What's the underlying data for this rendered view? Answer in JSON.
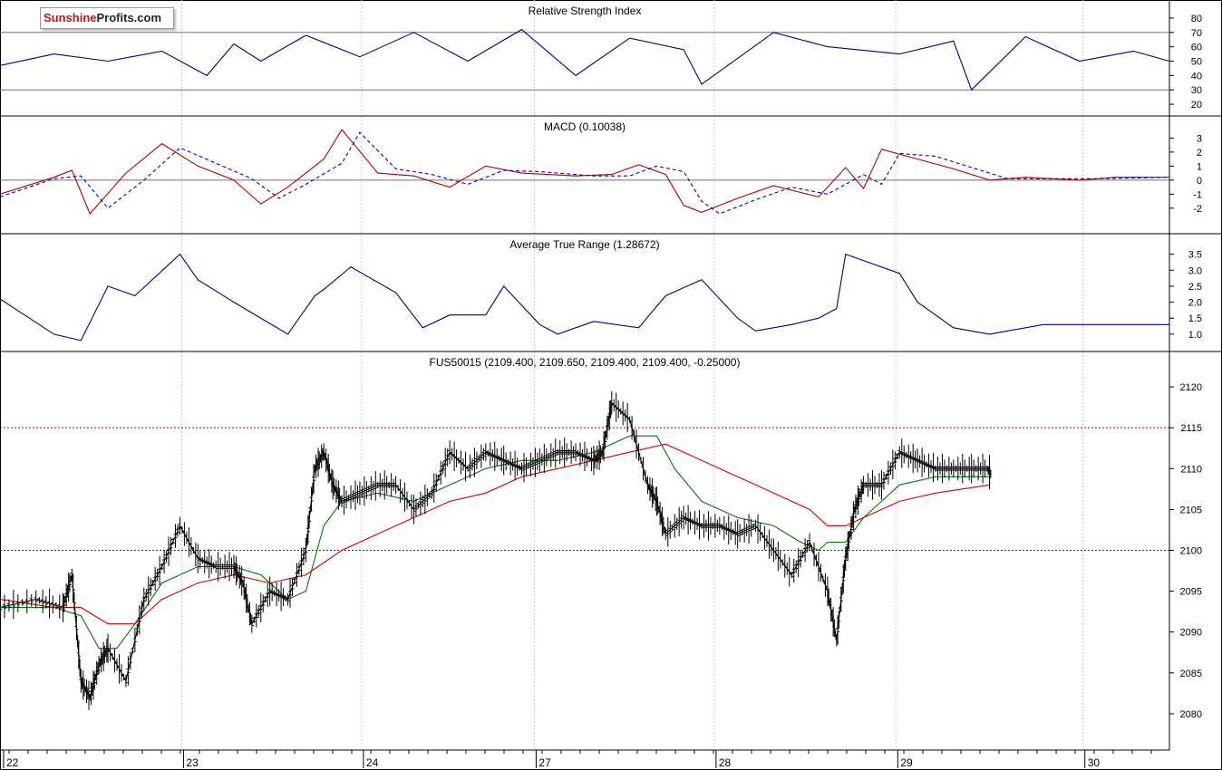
{
  "brand": {
    "part1": "Sunshine",
    "part2": "Profits.com"
  },
  "chart_data": [
    {
      "type": "line",
      "title": "Relative Strength Index",
      "ylim": [
        15,
        85
      ],
      "yticks": [
        20,
        30,
        40,
        50,
        60,
        70,
        80
      ],
      "hlines": [
        30,
        70
      ],
      "series": [
        {
          "color": "#000080",
          "x": [
            0,
            0.3,
            0.6,
            0.9,
            1.15,
            1.3,
            1.45,
            1.7,
            2.0,
            2.3,
            2.6,
            2.9,
            3.2,
            3.5,
            3.8,
            3.9,
            4.3,
            4.6,
            5.0,
            5.3,
            5.4,
            5.7,
            6.0,
            6.3,
            6.5
          ],
          "values": [
            47,
            55,
            50,
            57,
            40,
            62,
            50,
            68,
            53,
            70,
            50,
            72,
            40,
            66,
            58,
            34,
            70,
            60,
            55,
            64,
            30,
            67,
            50,
            57,
            50
          ]
        }
      ]
    },
    {
      "type": "line",
      "title": "MACD (0.10038)",
      "ylim": [
        -3.5,
        3.8
      ],
      "yticks": [
        -2,
        -1,
        0,
        1,
        2,
        3
      ],
      "hlines": [
        0
      ],
      "series": [
        {
          "color": "#b00000",
          "dash": false,
          "x": [
            0,
            0.3,
            0.4,
            0.5,
            0.7,
            0.9,
            1.1,
            1.3,
            1.45,
            1.6,
            1.8,
            1.9,
            2.1,
            2.3,
            2.5,
            2.7,
            2.9,
            3.2,
            3.4,
            3.55,
            3.7,
            3.8,
            3.9,
            4.1,
            4.3,
            4.55,
            4.7,
            4.8,
            4.9,
            5.1,
            5.3,
            5.5,
            5.7,
            6.0,
            6.2,
            6.5
          ],
          "values": [
            -1.0,
            0.2,
            0.7,
            -2.4,
            0.5,
            2.6,
            1.0,
            0.0,
            -1.7,
            -0.5,
            1.5,
            3.6,
            0.5,
            0.3,
            -0.5,
            1.0,
            0.5,
            0.3,
            0.4,
            1.1,
            0.4,
            -1.8,
            -2.3,
            -1.3,
            -0.4,
            -1.2,
            0.9,
            -0.6,
            2.2,
            1.5,
            0.8,
            0.0,
            0.2,
            0.0,
            0.2,
            0.2
          ]
        },
        {
          "color": "#0000cc",
          "dash": true,
          "x": [
            0,
            0.3,
            0.45,
            0.6,
            0.8,
            1.0,
            1.2,
            1.4,
            1.55,
            1.7,
            1.9,
            2.0,
            2.2,
            2.4,
            2.6,
            2.8,
            3.0,
            3.3,
            3.5,
            3.65,
            3.8,
            3.9,
            4.0,
            4.2,
            4.4,
            4.6,
            4.8,
            4.9,
            5.0,
            5.2,
            5.4,
            5.6,
            5.8,
            6.1,
            6.5
          ],
          "values": [
            -1.2,
            0.1,
            0.3,
            -2.0,
            0.0,
            2.3,
            1.2,
            0.1,
            -1.3,
            -0.3,
            1.2,
            3.4,
            0.8,
            0.4,
            -0.3,
            0.7,
            0.6,
            0.3,
            0.3,
            1.0,
            0.6,
            -1.5,
            -2.4,
            -1.4,
            -0.5,
            -1.0,
            0.4,
            -0.3,
            1.9,
            1.7,
            0.9,
            0.1,
            0.1,
            0.1,
            0.2
          ]
        }
      ]
    },
    {
      "type": "line",
      "title": "Average True Range (1.28672)",
      "ylim": [
        0.6,
        3.8
      ],
      "yticks": [
        1.0,
        1.5,
        2.0,
        2.5,
        3.0,
        3.5
      ],
      "series": [
        {
          "color": "#000080",
          "x": [
            0,
            0.3,
            0.45,
            0.6,
            0.75,
            1.0,
            1.1,
            1.3,
            1.6,
            1.75,
            1.8,
            1.95,
            2.2,
            2.35,
            2.5,
            2.7,
            2.8,
            3.0,
            3.1,
            3.3,
            3.55,
            3.7,
            3.9,
            4.1,
            4.2,
            4.4,
            4.55,
            4.65,
            4.7,
            5.0,
            5.1,
            5.3,
            5.5,
            5.6,
            5.8,
            6.0,
            6.5
          ],
          "values": [
            2.1,
            1.0,
            0.8,
            2.5,
            2.2,
            3.5,
            2.7,
            2.0,
            1.0,
            2.2,
            2.4,
            3.1,
            2.3,
            1.2,
            1.6,
            1.6,
            2.5,
            1.3,
            1.0,
            1.4,
            1.2,
            2.2,
            2.7,
            1.5,
            1.1,
            1.3,
            1.5,
            1.8,
            3.5,
            2.9,
            2.0,
            1.2,
            1.0,
            1.1,
            1.3,
            1.3,
            1.3
          ]
        }
      ]
    },
    {
      "type": "line",
      "title": "FUS50015 (2109.400, 2109.650, 2109.400, 2109.400, -0.25000)",
      "ylim": [
        2076,
        2123
      ],
      "yticks": [
        2080,
        2085,
        2090,
        2095,
        2100,
        2105,
        2110,
        2115,
        2120
      ],
      "hlines": [
        2100,
        2115
      ],
      "xlim": [
        0,
        6.5
      ],
      "xticks": [
        {
          "label": "22",
          "x": 0.02
        },
        {
          "label": "23",
          "x": 1.02
        },
        {
          "label": "24",
          "x": 2.02
        },
        {
          "label": "27",
          "x": 2.98
        },
        {
          "label": "28",
          "x": 3.98
        },
        {
          "label": "29",
          "x": 4.99
        },
        {
          "label": "30",
          "x": 6.03
        }
      ],
      "series": [
        {
          "name": "price",
          "color": "#000000",
          "x": [
            0,
            0.2,
            0.35,
            0.4,
            0.45,
            0.5,
            0.55,
            0.6,
            0.7,
            0.8,
            0.9,
            1.0,
            1.1,
            1.2,
            1.3,
            1.35,
            1.4,
            1.5,
            1.6,
            1.7,
            1.75,
            1.8,
            1.85,
            1.9,
            2.0,
            2.1,
            2.2,
            2.3,
            2.4,
            2.5,
            2.6,
            2.7,
            2.8,
            2.9,
            3.0,
            3.1,
            3.2,
            3.3,
            3.35,
            3.4,
            3.5,
            3.6,
            3.65,
            3.7,
            3.8,
            3.9,
            4.0,
            4.1,
            4.2,
            4.3,
            4.4,
            4.5,
            4.6,
            4.65,
            4.7,
            4.75,
            4.8,
            4.9,
            5.0,
            5.1,
            5.2,
            5.3,
            5.4,
            5.5,
            5.5
          ],
          "values": [
            2093,
            2094,
            2093,
            2097,
            2084,
            2082,
            2086,
            2088,
            2084,
            2094,
            2098,
            2103,
            2099,
            2098,
            2098,
            2096,
            2091,
            2095,
            2094,
            2100,
            2110,
            2112,
            2108,
            2106,
            2107,
            2108,
            2108,
            2105,
            2107,
            2112,
            2110,
            2112,
            2111,
            2110,
            2111,
            2112,
            2112,
            2111,
            2112,
            2118,
            2116,
            2108,
            2106,
            2102,
            2104,
            2103,
            2103,
            2102,
            2103,
            2100,
            2097,
            2101,
            2095,
            2089,
            2099,
            2105,
            2108,
            2108,
            2112,
            2111,
            2110,
            2110,
            2110,
            2110,
            2109
          ]
        },
        {
          "name": "short MA",
          "color": "#007700",
          "x": [
            0,
            0.3,
            0.45,
            0.55,
            0.65,
            0.75,
            0.9,
            1.1,
            1.3,
            1.45,
            1.6,
            1.7,
            1.8,
            1.9,
            2.1,
            2.3,
            2.5,
            2.7,
            2.9,
            3.1,
            3.3,
            3.5,
            3.65,
            3.75,
            3.9,
            4.1,
            4.3,
            4.45,
            4.55,
            4.6,
            4.7,
            4.8,
            4.9,
            5.0,
            5.2,
            5.5
          ],
          "values": [
            2093,
            2093,
            2092,
            2088,
            2088,
            2091,
            2096,
            2098,
            2098,
            2097,
            2094,
            2095,
            2103,
            2106,
            2107,
            2106,
            2108,
            2110,
            2111,
            2111,
            2112,
            2114,
            2114,
            2110,
            2106,
            2104,
            2103,
            2101,
            2100,
            2101,
            2101,
            2104,
            2106,
            2108,
            2109,
            2109
          ]
        },
        {
          "name": "long MA",
          "color": "#cc0000",
          "x": [
            0,
            0.3,
            0.45,
            0.6,
            0.75,
            0.9,
            1.1,
            1.3,
            1.5,
            1.7,
            1.9,
            2.1,
            2.3,
            2.5,
            2.7,
            2.9,
            3.1,
            3.3,
            3.5,
            3.7,
            3.9,
            4.1,
            4.3,
            4.5,
            4.6,
            4.7,
            4.8,
            4.9,
            5.0,
            5.2,
            5.5
          ],
          "values": [
            2094,
            2093,
            2093,
            2091,
            2091,
            2094,
            2096,
            2097,
            2096,
            2097,
            2100,
            2102,
            2104,
            2106,
            2107,
            2109,
            2110,
            2111,
            2112,
            2113,
            2111,
            2109,
            2107,
            2105,
            2103,
            2103,
            2104,
            2105,
            2106,
            2107,
            2108
          ]
        }
      ]
    }
  ]
}
